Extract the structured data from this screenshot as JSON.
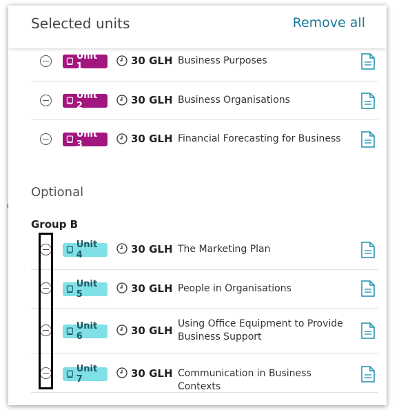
{
  "header": {
    "title": "Selected units",
    "remove_all": "Remove all"
  },
  "mandatory_units": [
    {
      "badge": "Unit 1",
      "glh": "30 GLH",
      "name": "Business Purposes"
    },
    {
      "badge": "Unit 2",
      "glh": "30 GLH",
      "name": "Business Organisations"
    },
    {
      "badge": "Unit 3",
      "glh": "30 GLH",
      "name": "Financial Forecasting for Business"
    }
  ],
  "optional": {
    "label": "Optional",
    "group_label": "Group B",
    "units": [
      {
        "badge": "Unit 4",
        "glh": "30 GLH",
        "name": "The Marketing Plan"
      },
      {
        "badge": "Unit 5",
        "glh": "30 GLH",
        "name": "People in Organisations"
      },
      {
        "badge": "Unit 6",
        "glh": "30 GLH",
        "name": "Using Office Equipment to Provide Business Support"
      },
      {
        "badge": "Unit 7",
        "glh": "30 GLH",
        "name": "Communication in Business Contexts"
      }
    ]
  },
  "colors": {
    "mandatory_badge": "#a3167f",
    "optional_badge": "#7fe0e6",
    "link": "#1b7a99"
  },
  "icons": {
    "remove": "minus-circle-icon",
    "book": "book-icon",
    "clock": "clock-icon",
    "document": "document-icon"
  }
}
